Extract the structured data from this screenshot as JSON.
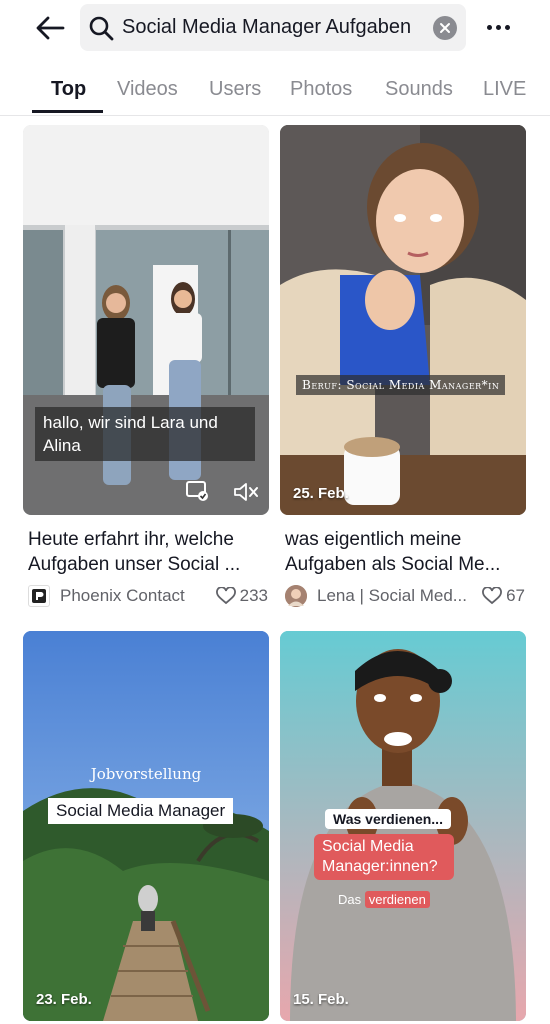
{
  "search": {
    "query": "Social Media Manager Aufgaben"
  },
  "tabs": [
    {
      "label": "Top"
    },
    {
      "label": "Videos"
    },
    {
      "label": "Users"
    },
    {
      "label": "Photos"
    },
    {
      "label": "Sounds"
    },
    {
      "label": "LIVE"
    }
  ],
  "results": [
    {
      "overlay_text": "hallo, wir sind Lara und Alina",
      "title": "Heute erfahrt ihr, welche Aufgaben unser Social ...",
      "author": "Phoenix Contact",
      "likes": "233"
    },
    {
      "overlay_text": "Beruf: Social Media Manager*in",
      "date": "25. Feb.",
      "title": "was eigentlich meine Aufgaben als Social Me...",
      "author": "Lena | Social Med...",
      "likes": "67"
    },
    {
      "overlay_heading": "Jobvorstellung",
      "overlay_text": "Social Media Manager",
      "date": "23. Feb."
    },
    {
      "overlay_question": "Was verdienen...",
      "overlay_text": "Social Media Manager:innen?",
      "overlay_sub_prefix": "Das",
      "overlay_sub_highlight": "verdienen",
      "date": "15. Feb."
    }
  ],
  "colors": {
    "accent_red": "#e05a5c",
    "text_primary": "#161823",
    "text_secondary": "#616268"
  }
}
